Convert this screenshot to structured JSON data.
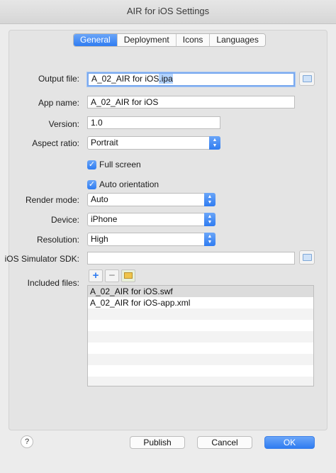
{
  "window": {
    "title": "AIR for iOS Settings"
  },
  "tabs": [
    "General",
    "Deployment",
    "Icons",
    "Languages"
  ],
  "form": {
    "output_file": {
      "label": "Output file:",
      "value_prefix": "A_02_AIR for iOS",
      "value_selected_suffix": ".ipa"
    },
    "app_name": {
      "label": "App name:",
      "value": "A_02_AIR for iOS"
    },
    "version": {
      "label": "Version:",
      "value": "1.0"
    },
    "aspect_ratio": {
      "label": "Aspect ratio:",
      "value": "Portrait"
    },
    "full_screen": {
      "label": "Full screen",
      "checked": true
    },
    "auto_orientation": {
      "label": "Auto orientation",
      "checked": true
    },
    "render_mode": {
      "label": "Render mode:",
      "value": "Auto"
    },
    "device": {
      "label": "Device:",
      "value": "iPhone"
    },
    "resolution": {
      "label": "Resolution:",
      "value": "High"
    },
    "ios_simulator_sdk": {
      "label": "iOS Simulator SDK:",
      "value": ""
    },
    "included_files": {
      "label": "Included files:",
      "items": [
        "A_02_AIR for iOS.swf",
        "A_02_AIR for iOS-app.xml"
      ]
    }
  },
  "footer": {
    "help": "?",
    "publish": "Publish",
    "cancel": "Cancel",
    "ok": "OK"
  },
  "colors": {
    "accent": "#2f7cf1",
    "selection": "#b3d3fd"
  }
}
